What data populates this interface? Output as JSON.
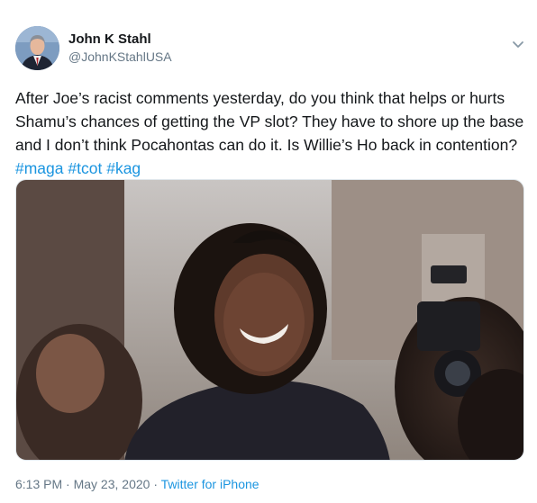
{
  "author": {
    "display_name": "John K Stahl",
    "handle": "@JohnKStahlUSA",
    "avatar_icon": "avatar-photo"
  },
  "menu_icon": "chevron-down-icon",
  "tweet": {
    "text": "After Joe’s racist comments yesterday, do you think that helps or hurts Shamu’s chances of getting the VP slot? They have to shore up the base and I don’t think Pocahontas can do it. Is Willie’s Ho back in contention?",
    "hashtags": [
      "#maga",
      "#tcot",
      "#kag"
    ]
  },
  "media": {
    "kind": "photo"
  },
  "footer": {
    "time": "6:13 PM",
    "separator": " · ",
    "date": "May 23, 2020",
    "source": "Twitter for iPhone"
  },
  "colors": {
    "link": "#1b95e0",
    "secondary_text": "#657786",
    "primary_text": "#14171a"
  }
}
